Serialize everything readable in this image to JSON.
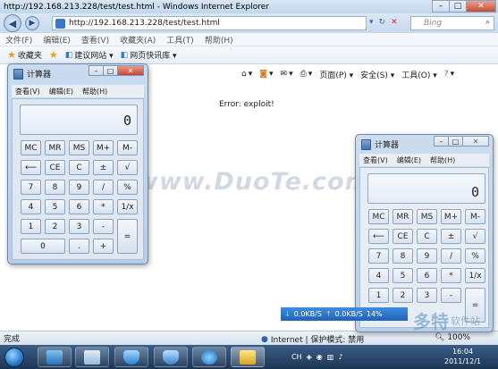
{
  "ie": {
    "title": "http://192.168.213.228/test/test.html - Windows Internet Explorer",
    "address": "http://192.168.213.228/test/test.html",
    "search_placeholder": "Bing",
    "menu": [
      "文件(F)",
      "编辑(E)",
      "查看(V)",
      "收藏夹(A)",
      "工具(T)",
      "帮助(H)"
    ],
    "favorites_label": "收藏夹",
    "fav_links": [
      "建议网站 ▾",
      "网页快讯库 ▾"
    ],
    "cmd": [
      "页面(P) ▾",
      "安全(S) ▾",
      "工具(O) ▾"
    ],
    "page_text": "Error: exploit!",
    "status": "完成",
    "zone": "Internet | 保护模式: 禁用",
    "zoom": "100%"
  },
  "calc1": {
    "title": "计算器",
    "menu": [
      "查看(V)",
      "编辑(E)",
      "帮助(H)"
    ],
    "display": "0",
    "keys": [
      "MC",
      "MR",
      "MS",
      "M+",
      "M-",
      "⟵",
      "CE",
      "C",
      "±",
      "√",
      "7",
      "8",
      "9",
      "/",
      "%",
      "4",
      "5",
      "6",
      "*",
      "1/x",
      "1",
      "2",
      "3",
      "-",
      "=",
      "0",
      ".",
      "+"
    ]
  },
  "calc2": {
    "title": "计算器",
    "menu": [
      "查看(V)",
      "编辑(E)",
      "帮助(H)"
    ],
    "display": "0",
    "keys": [
      "MC",
      "MR",
      "MS",
      "M+",
      "M-",
      "⟵",
      "CE",
      "C",
      "±",
      "√",
      "7",
      "8",
      "9",
      "/",
      "%",
      "4",
      "5",
      "6",
      "*",
      "1/x",
      "1",
      "2",
      "3",
      "-",
      "="
    ]
  },
  "speedbar": {
    "down": "0.0KB/S",
    "up": "0.0KB/S",
    "pct": "14%"
  },
  "watermark": "www.DuoTe.com",
  "logo2": {
    "big": "多特",
    "small": "软件站"
  },
  "taskbar": {
    "lang": "CH",
    "time": "16:04",
    "date": "2011/12/1"
  }
}
